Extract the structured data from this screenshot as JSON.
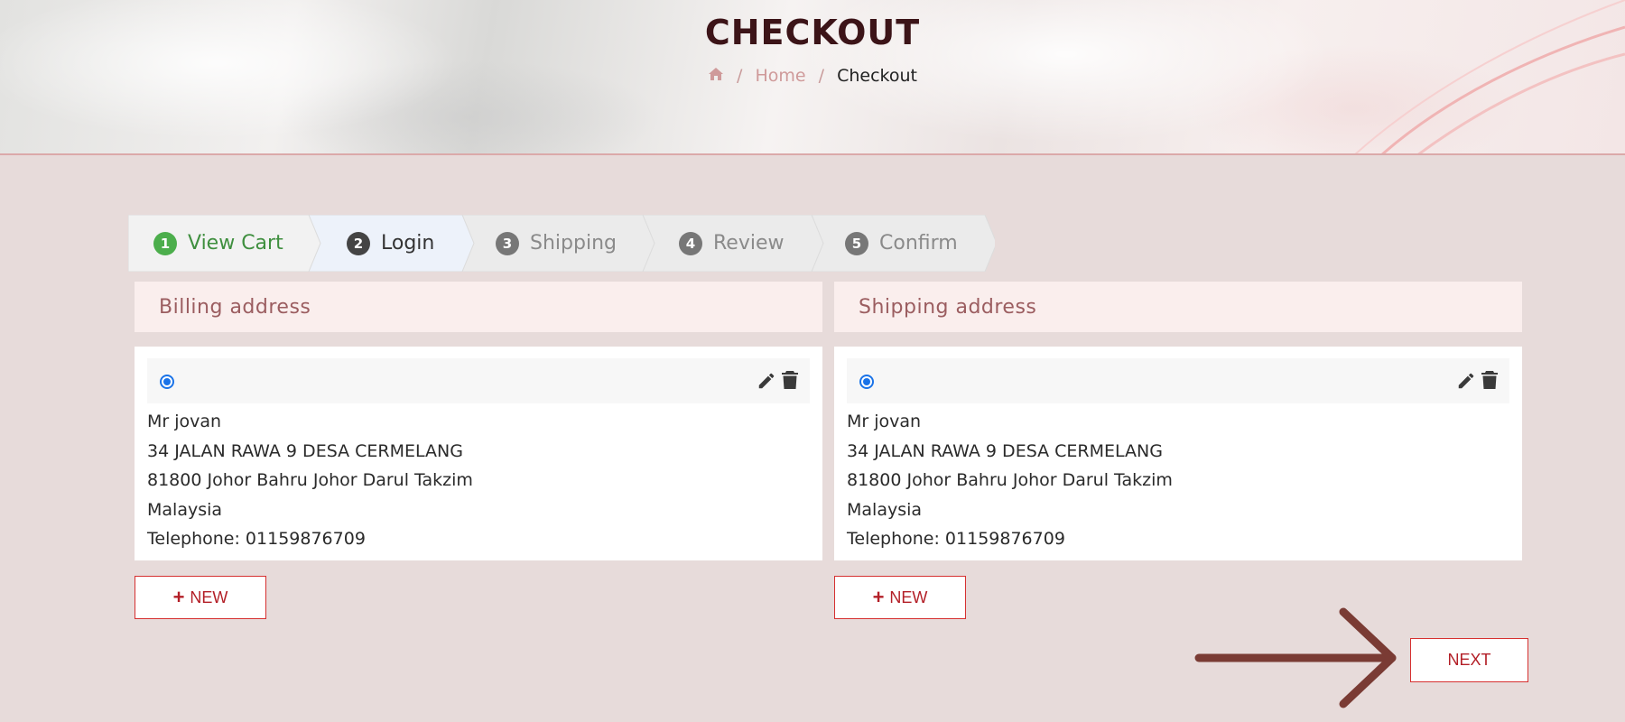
{
  "header": {
    "title": "CHECKOUT",
    "breadcrumb": {
      "separator": "/",
      "home_label": "Home",
      "current": "Checkout"
    }
  },
  "steps": [
    {
      "number": "1",
      "label": "View Cart",
      "state": "done"
    },
    {
      "number": "2",
      "label": "Login",
      "state": "active"
    },
    {
      "number": "3",
      "label": "Shipping",
      "state": "pending"
    },
    {
      "number": "4",
      "label": "Review",
      "state": "pending"
    },
    {
      "number": "5",
      "label": "Confirm",
      "state": "pending"
    }
  ],
  "billing": {
    "heading": "Billing address",
    "selected": true,
    "name": "Mr jovan",
    "line1": "34 JALAN RAWA 9 DESA CERMELANG",
    "line2": "81800 Johor Bahru Johor Darul Takzim",
    "country": "Malaysia",
    "telephone": "Telephone: 01159876709",
    "new_label": "NEW"
  },
  "shipping": {
    "heading": "Shipping address",
    "selected": true,
    "name": "Mr jovan",
    "line1": "34 JALAN RAWA 9 DESA CERMELANG",
    "line2": "81800 Johor Bahru Johor Darul Takzim",
    "country": "Malaysia",
    "telephone": "Telephone: 01159876709",
    "new_label": "NEW"
  },
  "next_label": "NEXT",
  "colors": {
    "accent": "#b31f27",
    "step_done": "#4cae4c",
    "step_active_bg": "#edf2fa",
    "heading_text": "#9b5d60",
    "arrow": "#7a3b34"
  },
  "icons": [
    "home-icon",
    "edit-icon",
    "trash-icon",
    "plus-icon",
    "arrow-right-icon"
  ]
}
